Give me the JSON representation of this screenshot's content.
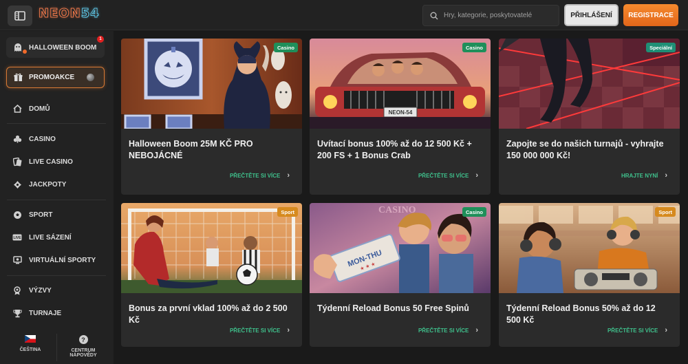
{
  "header": {
    "logo_part1": "NEON",
    "logo_part2": "54",
    "search_placeholder": "Hry, kategorie, poskytovatelé",
    "login_label": "PŘIHLÁŠENÍ",
    "register_label": "REGISTRACE"
  },
  "sidebar": {
    "halloween_label": "HALLOWEEN BOOM",
    "halloween_badge": "1",
    "promo_label": "PROMOAKCE",
    "items": [
      {
        "label": "DOMŮ",
        "icon": "home-icon"
      },
      {
        "label": "CASINO",
        "icon": "cards-icon"
      },
      {
        "label": "LIVE CASINO",
        "icon": "live-cards-icon"
      },
      {
        "label": "JACKPOTY",
        "icon": "diamond-icon"
      },
      {
        "label": "SPORT",
        "icon": "football-icon"
      },
      {
        "label": "LIVE SÁZENÍ",
        "icon": "live-icon"
      },
      {
        "label": "VIRTUÁLNÍ SPORTY",
        "icon": "monitor-icon"
      },
      {
        "label": "VÝZVY",
        "icon": "medal-icon"
      },
      {
        "label": "TURNAJE",
        "icon": "trophy-icon"
      }
    ],
    "language_label": "ČEŠTINA",
    "help_label": "CENTRUM NÁPOVĚDY"
  },
  "cards": [
    {
      "tag": "Casino",
      "title": "Halloween Boom 25M KČ PRO NEBOJÁCNÉ",
      "link": "PŘEČTĚTE SI VÍCE"
    },
    {
      "tag": "Casino",
      "title": "Uvítací bonus 100% až do 12 500 Kč + 200 FS + 1 Bonus Crab",
      "link": "PŘEČTĚTE SI VÍCE"
    },
    {
      "tag": "Speciální",
      "title": "Zapojte se do našich turnajů - vyhrajte 150 000 000 Kč!",
      "link": "HRAJTE NYNÍ"
    },
    {
      "tag": "Sport",
      "title": "Bonus za první vklad 100% až do 2 500 Kč",
      "link": "PŘEČTĚTE SI VÍCE"
    },
    {
      "tag": "Casino",
      "title": "Týdenní Reload Bonus 50 Free Spinů",
      "link": "PŘEČTĚTE SI VÍCE"
    },
    {
      "tag": "Sport",
      "title": "Týdenní Reload Bonus 50% až do 12 500 Kč",
      "link": "PŘEČTĚTE SI VÍCE"
    }
  ],
  "images": {
    "ticket_text": "MON-THU",
    "plate_text": "NEON-54",
    "casino_sign": "CASINO"
  },
  "colors": {
    "accent_orange": "#e8702a",
    "accent_green": "#3fc08c"
  }
}
